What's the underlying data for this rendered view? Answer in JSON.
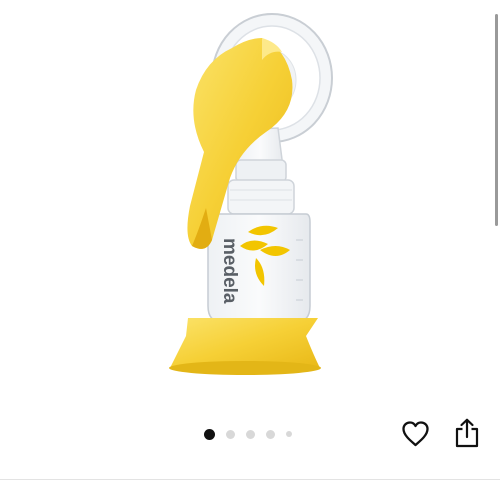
{
  "product_image": {
    "brand_text": "medela",
    "icons": [
      "breast-pump-product",
      "medela-flower-logo"
    ]
  },
  "carousel": {
    "total": 5,
    "current": 1
  },
  "actions": {
    "favorite_icon": "heart-icon",
    "share_icon": "share-icon"
  },
  "colors": {
    "brand_yellow": "#f6d036",
    "dot_active": "#111111",
    "dot_inactive": "#d8d8d8"
  }
}
